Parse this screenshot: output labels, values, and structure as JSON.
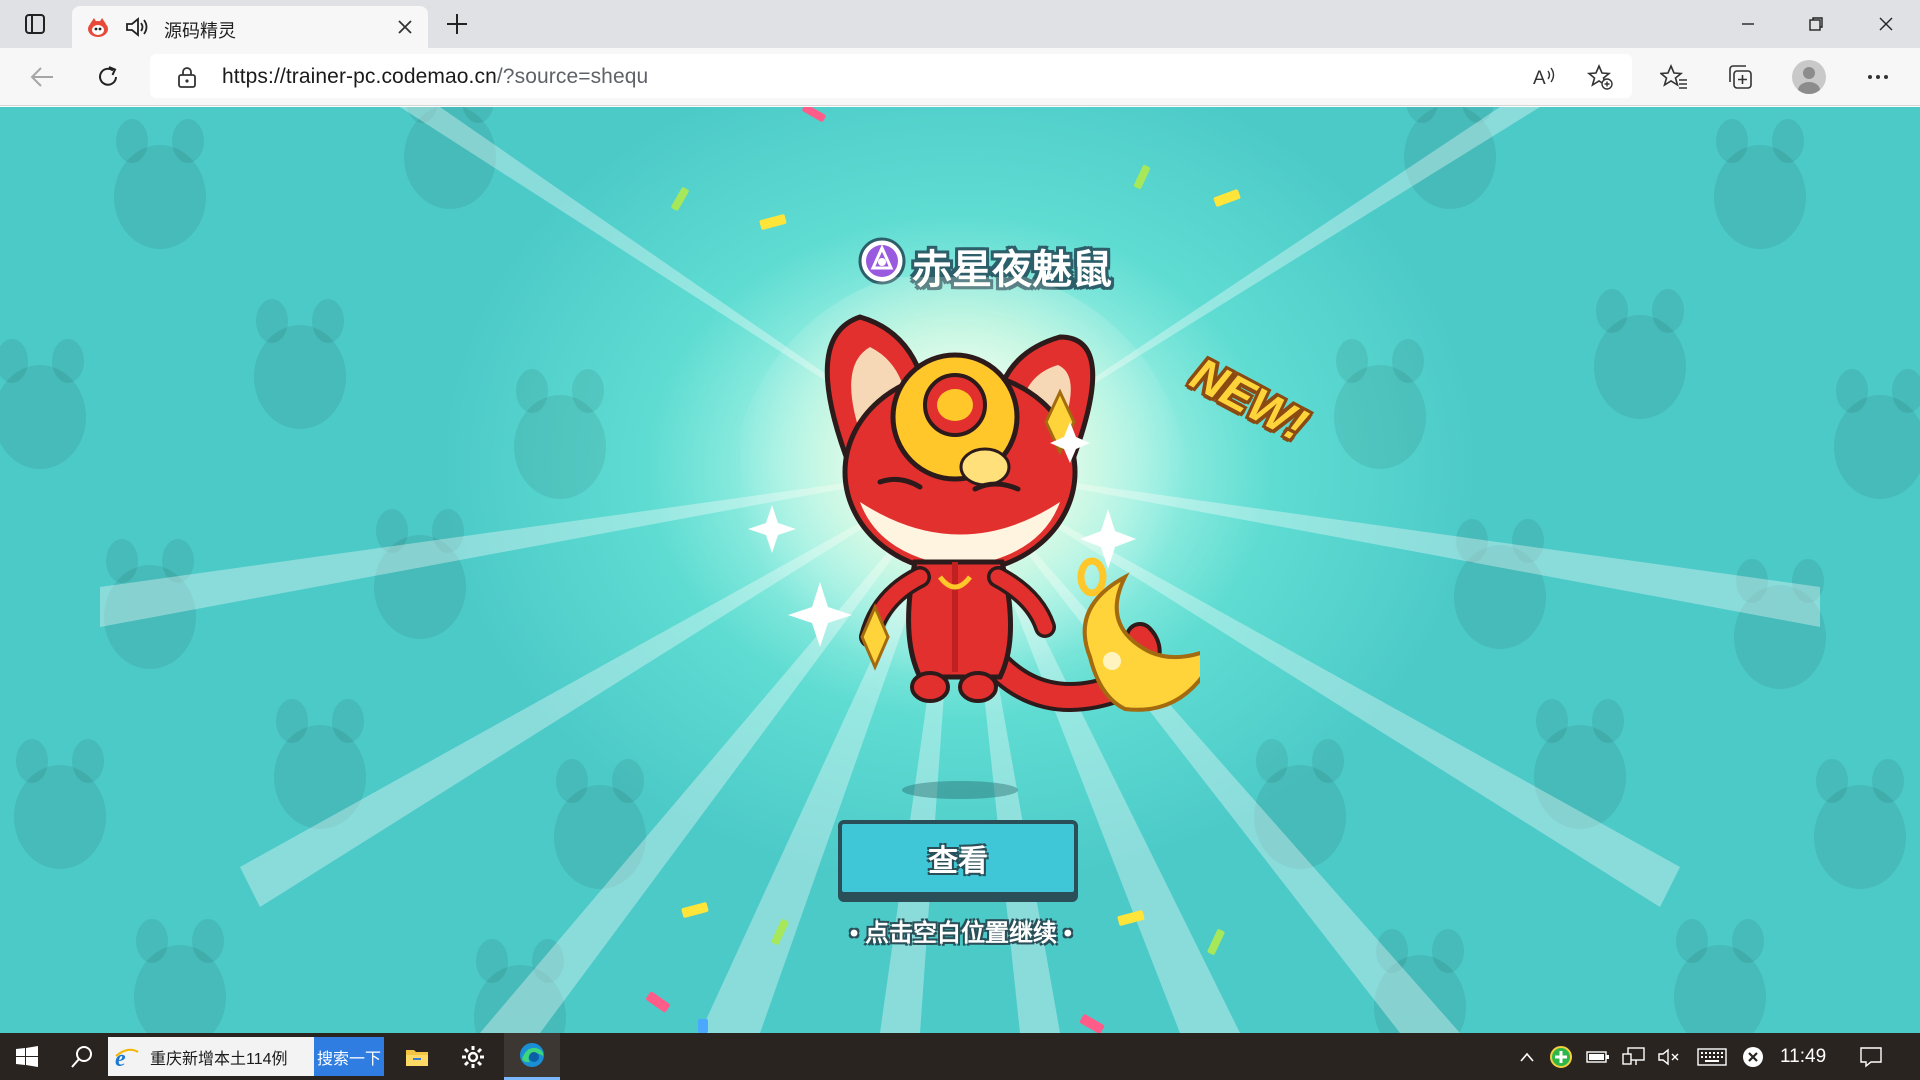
{
  "browser": {
    "tab": {
      "title": "源码精灵",
      "favicon": "codemao-icon",
      "audio_icon": "speaker-icon"
    },
    "url": {
      "host": "https://trainer-pc.codemao.cn",
      "path": "/?source=shequ"
    },
    "icons": [
      "tab-actions-icon",
      "close-icon",
      "plus-icon",
      "minimize-icon",
      "restore-icon",
      "window-close-icon",
      "back-arrow-icon",
      "refresh-icon",
      "lock-icon",
      "read-aloud-icon",
      "add-favorite-icon",
      "favorites-icon",
      "collections-icon",
      "profile-icon",
      "more-icon"
    ]
  },
  "game": {
    "creature_name": "赤星夜魅鼠",
    "element_badge_icon": "element-badge-icon",
    "new_badge": "NEW!",
    "view_button": "查看",
    "continue_hint": "• 点击空白位置继续 •",
    "colors": {
      "background": "#4ccac8",
      "button": "#3fc7d8",
      "outline": "#2a4f58",
      "new": "#ffd43a",
      "creature_red": "#e2302f",
      "creature_gold": "#ffc72a"
    }
  },
  "taskbar": {
    "search_text": "重庆新增本土114例",
    "search_button": "搜索一下",
    "clock": "11:49",
    "icons": [
      "windows-start-icon",
      "search-icon",
      "ie-icon",
      "file-explorer-icon",
      "settings-gear-icon",
      "edge-icon",
      "chevron-up-icon",
      "security-plus-icon",
      "battery-icon",
      "network-icon",
      "mute-icon",
      "keyboard-icon",
      "close-circle-icon",
      "notification-icon"
    ]
  }
}
